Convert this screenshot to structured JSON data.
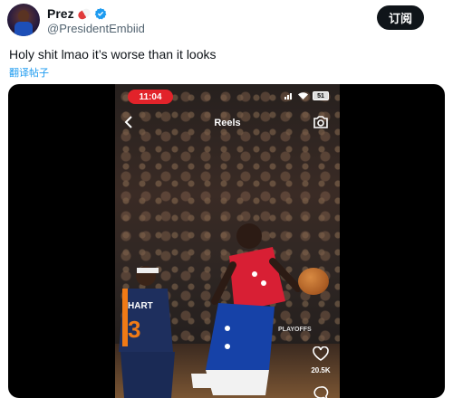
{
  "tweet": {
    "display_name": "Prez",
    "handle": "@PresidentEmbiid",
    "subscribe_label": "订阅",
    "text": "Holy shit lmao it’s worse than it looks",
    "translate_label": "翻译帖子",
    "accent_color": "#1d9bf0"
  },
  "video": {
    "status_time": "11:04",
    "battery": "51",
    "title": "Reels",
    "jersey_name": "HART",
    "jersey_number": "3",
    "board_text": "PLAYOFFS",
    "like_count": "20.5K"
  }
}
